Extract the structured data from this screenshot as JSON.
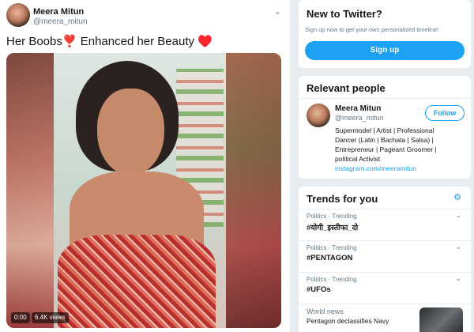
{
  "tweet": {
    "display_name": "Meera Mitun",
    "handle": "@meera_mitun",
    "caret_icon": "chevron-down-icon",
    "text_part1": "Her Boobs",
    "heart1": "❣️",
    "text_part2": " Enhanced her Beauty ",
    "heart2": "♥️",
    "video_time": "0:00",
    "video_views": "6.4K views"
  },
  "signup": {
    "title": "New to Twitter?",
    "subtitle": "Sign up now to get your own personalized timeline!",
    "button": "Sign up"
  },
  "relevant_people": {
    "title": "Relevant people",
    "name": "Meera Mitun",
    "handle": "@meera_mitun",
    "follow_label": "Follow",
    "bio": "Supermodel | Artist | Professional Dancer (Latin | Bachata | Salsa) | Entrepreneur | Pageant Groomer | political Activist",
    "link": "instagram.com/meeramitun"
  },
  "trends": {
    "title": "Trends for you",
    "settings_icon": "gear-icon",
    "items": [
      {
        "meta": "Politics · Trending",
        "name": "#योगी_इस्तीफा_दो"
      },
      {
        "meta": "Politics · Trending",
        "name": "#PENTAGON"
      },
      {
        "meta": "Politics · Trending",
        "name": "#UFOs"
      }
    ],
    "news": {
      "label": "World news",
      "title": "Pentagon declassifies Navy"
    }
  },
  "colors": {
    "accent": "#1da1f2",
    "heart": "#e0245e"
  }
}
